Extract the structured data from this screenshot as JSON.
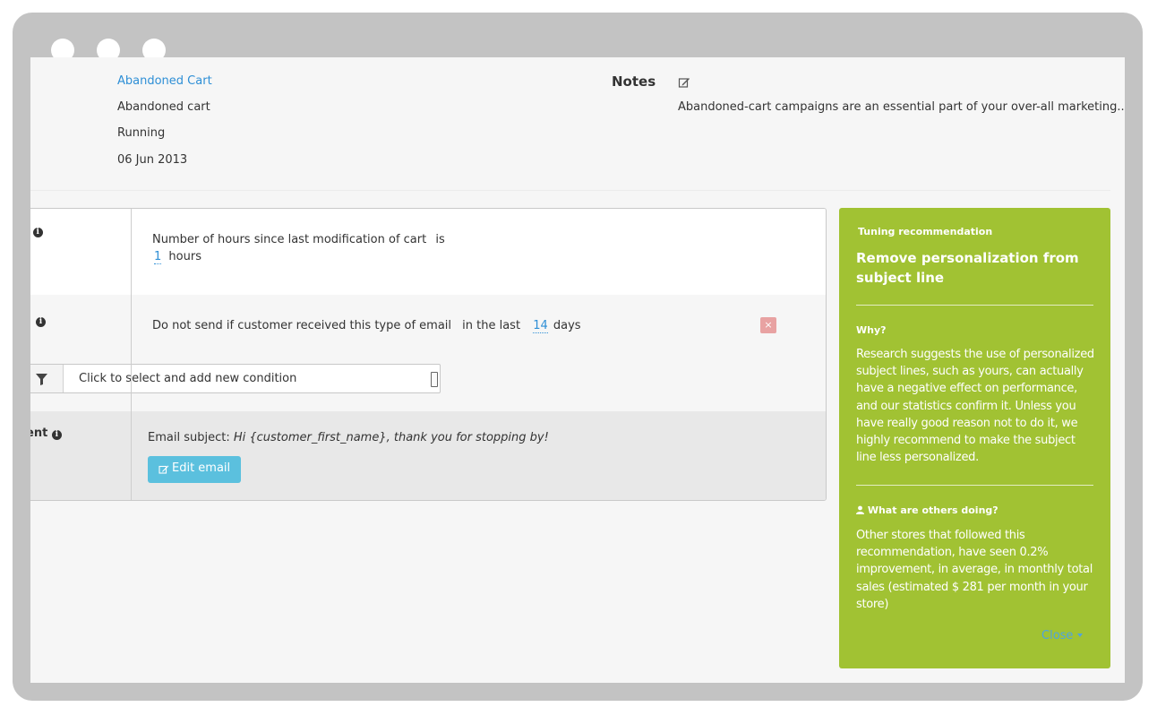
{
  "campaign": {
    "name": "Abandoned Cart",
    "type": "Abandoned cart",
    "status": "Running",
    "date": "06 Jun 2013"
  },
  "notes": {
    "label": "Notes",
    "text": "Abandoned-cart campaigns are an essential part of your over-all marketing..."
  },
  "rows": {
    "row1": {
      "label_fragment": ":",
      "condition": "Number of hours since last modification of cart",
      "operator": "is",
      "value": "1",
      "unit": "hours"
    },
    "row2": {
      "condition": "Do not send if customer received this type of email",
      "window_label": "in the last",
      "value": "14",
      "unit": "days",
      "remove_glyph": "×",
      "select_placeholder": "Click to select and add new condition"
    },
    "row3": {
      "label_fragment": "ent",
      "subject_label": "Email subject:",
      "subject_value": "Hi {customer_first_name}, thank you for stopping by!",
      "edit_button": "Edit email"
    }
  },
  "recommendation": {
    "eyebrow": "Tuning recommendation",
    "title": "Remove personalization from subject line",
    "why_heading": "Why?",
    "why_text": "Research suggests the use of personalized subject lines, such as yours, can actually have a negative effect on performance, and our statistics confirm it. Unless you have really good reason not to do it, we highly recommend to make the subject line less personalized.",
    "others_heading": "What are others doing?",
    "others_text": "Other stores that followed this recommendation, have seen 0.2% improvement, in average, in monthly total sales (estimated $ 281 per month in your store)",
    "close_label": "Close"
  },
  "colors": {
    "link": "#2e8fd6",
    "recommendation_bg": "#a1c233",
    "edit_button_bg": "#5bc0de",
    "remove_button_bg": "#e8a2a2",
    "close_link": "#4fa3e0"
  },
  "icons": [
    "edit-icon",
    "info-icon",
    "filter-icon",
    "pencil-icon",
    "user-icon",
    "caret-down-icon",
    "close-icon"
  ]
}
